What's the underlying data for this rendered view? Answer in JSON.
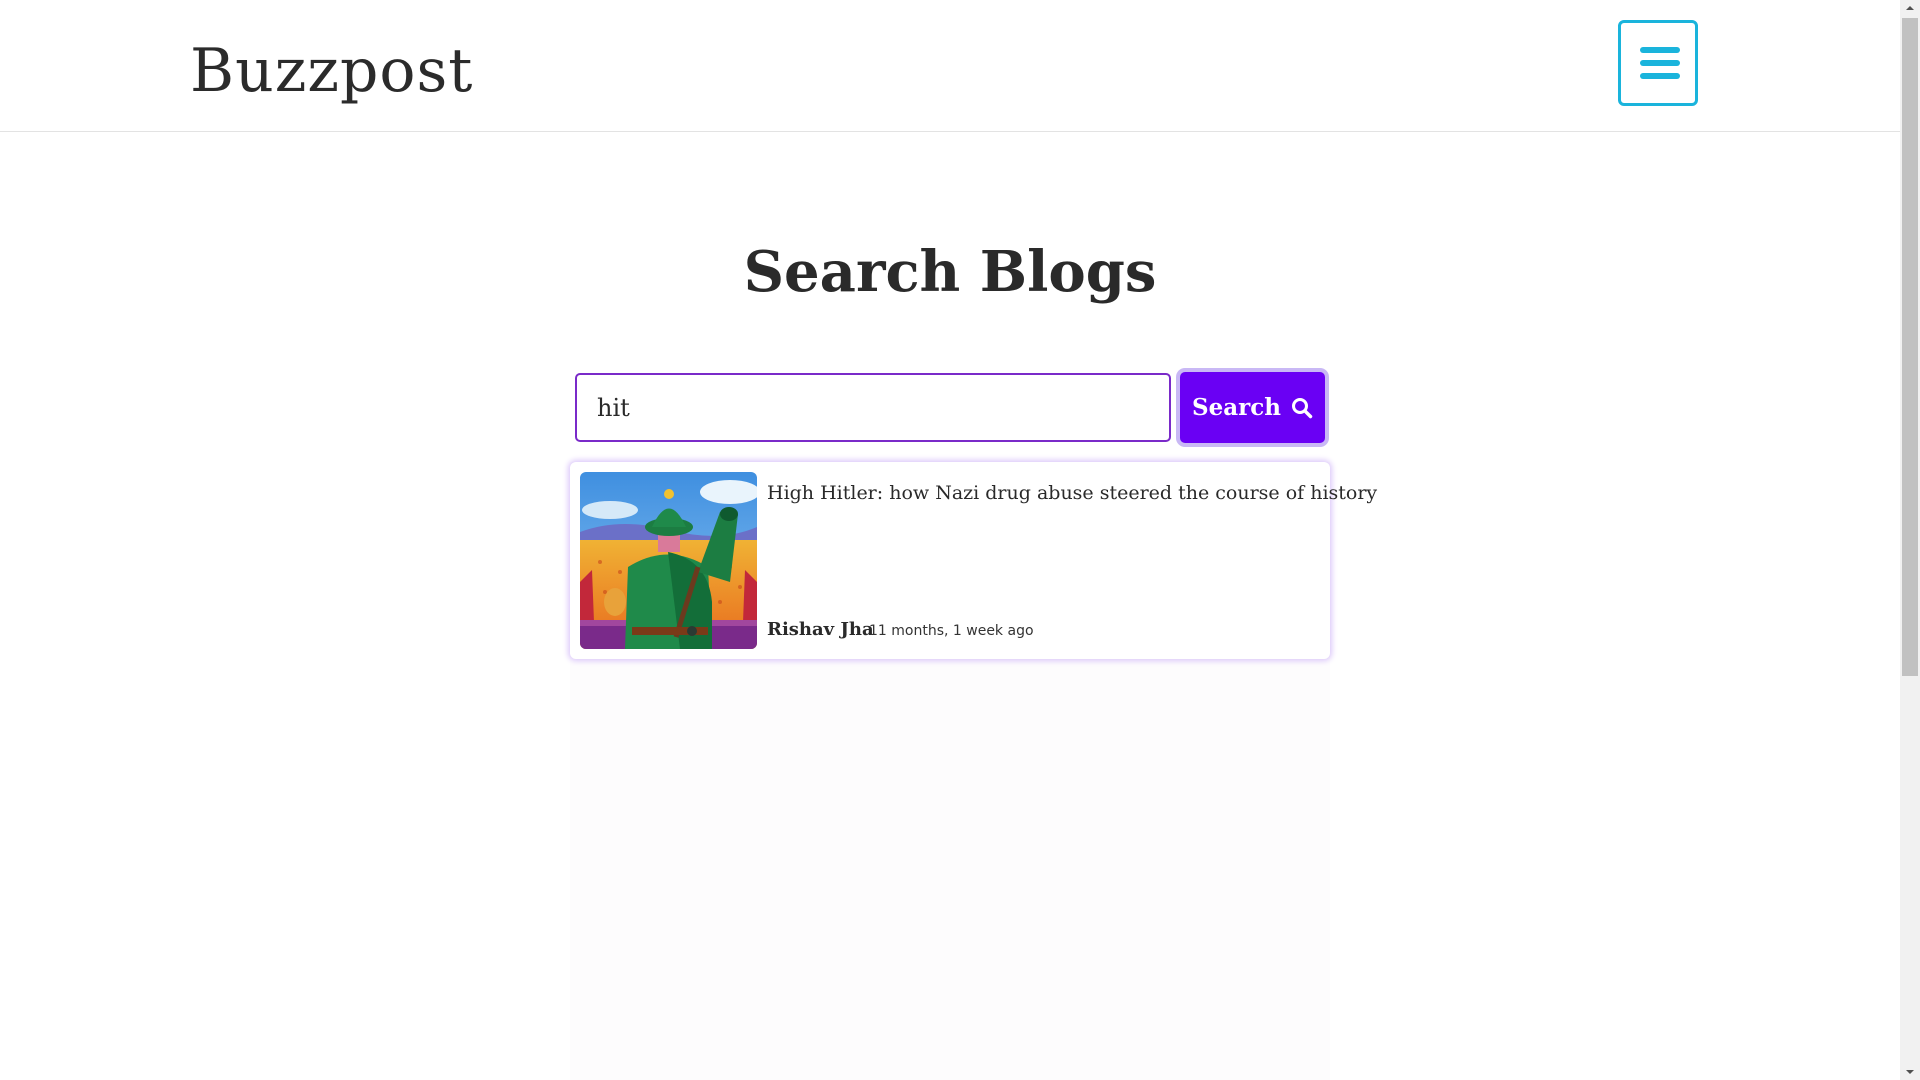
{
  "header": {
    "logo": "Buzzpost",
    "menu_icon": "hamburger-menu-icon",
    "accent_color": "#1ab4dc"
  },
  "main": {
    "title": "Search Blogs",
    "search": {
      "value": "hit",
      "placeholder": "",
      "button_label": "Search",
      "button_icon": "search-icon",
      "button_color": "#6a00f4"
    },
    "results": [
      {
        "title": "High Hitler: how Nazi drug abuse steered the course of history",
        "author": "Rishav Jha",
        "time": "11 months, 1 week ago",
        "thumbnail": "illustration of soldier in green uniform saluting over a field"
      }
    ]
  }
}
